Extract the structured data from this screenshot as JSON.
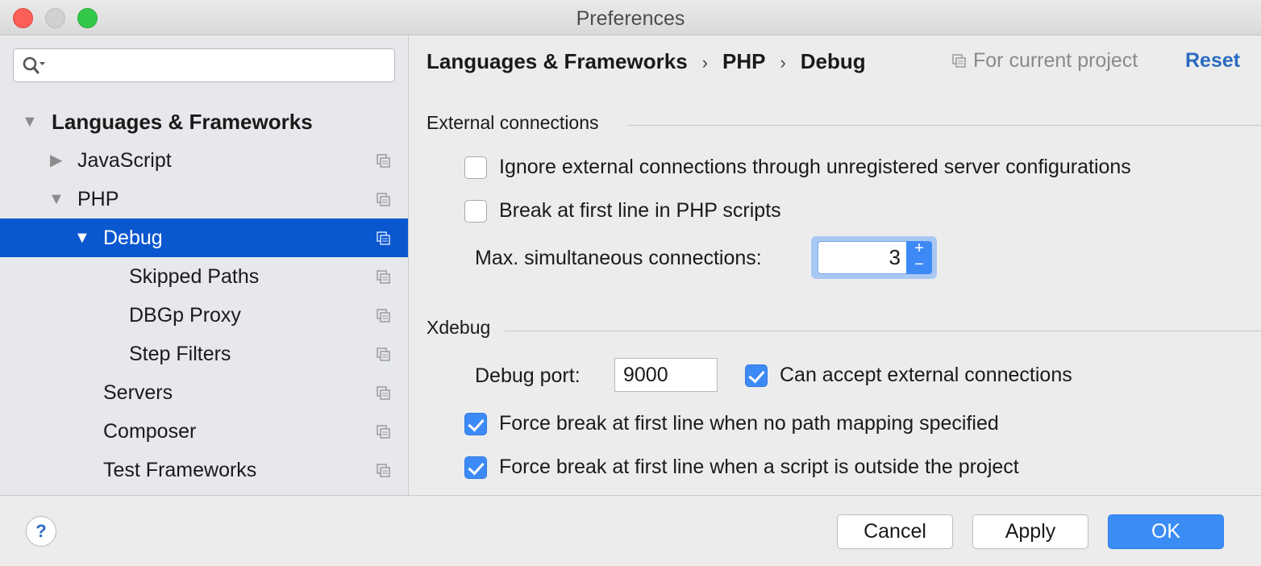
{
  "window": {
    "title": "Preferences"
  },
  "sidebar": {
    "search_placeholder": "",
    "items": [
      {
        "label": "Languages & Frameworks",
        "arrow": "▼"
      },
      {
        "label": "JavaScript",
        "arrow": "▶"
      },
      {
        "label": "PHP",
        "arrow": "▼"
      },
      {
        "label": "Debug",
        "arrow": "▼"
      },
      {
        "label": "Skipped Paths"
      },
      {
        "label": "DBGp Proxy"
      },
      {
        "label": "Step Filters"
      },
      {
        "label": "Servers"
      },
      {
        "label": "Composer"
      },
      {
        "label": "Test Frameworks"
      }
    ]
  },
  "header": {
    "breadcrumb": [
      "Languages & Frameworks",
      "PHP",
      "Debug"
    ],
    "separator": "›",
    "scope": "For current project",
    "reset": "Reset"
  },
  "external": {
    "title": "External connections",
    "ignore_label": "Ignore external connections through unregistered server configurations",
    "ignore_checked": false,
    "break_label": "Break at first line in PHP scripts",
    "break_checked": false,
    "max_label": "Max. simultaneous connections:",
    "max_value": "3",
    "plus": "+",
    "minus": "−"
  },
  "xdebug": {
    "title": "Xdebug",
    "port_label": "Debug port:",
    "port_value": "9000",
    "accept_label": "Can accept external connections",
    "accept_checked": true,
    "force_nomap_label": "Force break at first line when no path mapping specified",
    "force_nomap_checked": true,
    "force_outside_label": "Force break at first line when a script is outside the project",
    "force_outside_checked": true
  },
  "footer": {
    "help": "?",
    "cancel": "Cancel",
    "apply": "Apply",
    "ok": "OK"
  },
  "colors": {
    "selection": "#0b57d0",
    "accent": "#3b8df5",
    "link": "#2a6bc1"
  }
}
